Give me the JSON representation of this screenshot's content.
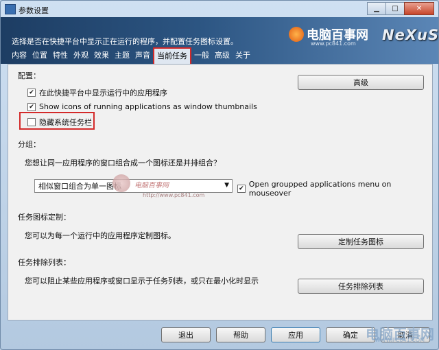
{
  "window": {
    "title": "参数设置"
  },
  "header": {
    "description": "选择是否在快捷平台中显示正在运行的程序，并配置任务图标设置。",
    "brand": "NeXuS",
    "watermark": {
      "name": "电脑百事网",
      "url": "www.pc841.com"
    }
  },
  "tabs": [
    {
      "label": "内容"
    },
    {
      "label": "位置"
    },
    {
      "label": "特性"
    },
    {
      "label": "外观"
    },
    {
      "label": "效果"
    },
    {
      "label": "主题"
    },
    {
      "label": "声音"
    },
    {
      "label": "当前任务",
      "active": true
    },
    {
      "label": "一般"
    },
    {
      "label": "高级"
    },
    {
      "label": "关于"
    }
  ],
  "config": {
    "title": "配置：",
    "advanced_button": "高级",
    "options": [
      {
        "label": "在此快捷平台中显示运行中的应用程序",
        "checked": true
      },
      {
        "label": "Show icons of running applications as window thumbnails",
        "checked": true
      },
      {
        "label": "隐藏系统任务栏",
        "checked": false
      }
    ]
  },
  "group": {
    "title": "分组：",
    "question": "您想让同一应用程序的窗口组合成一个图标还是并排组合？",
    "dropdown_value": "相似窗口组合为单一图标",
    "menu_option": {
      "label": "Open groupped applications menu on mouseover",
      "checked": true
    },
    "watermark": {
      "name": "电脑百事网",
      "url": "http://www.pc841.com"
    }
  },
  "task_icon": {
    "title": "任务图标定制：",
    "desc": "您可以为每一个运行中的应用程序定制图标。",
    "button": "定制任务图标"
  },
  "exclude": {
    "title": "任务排除列表：",
    "desc": "您可以阻止某些应用程序或窗口显示于任务列表，或只在最小化时显示",
    "button": "任务排除列表"
  },
  "footer": {
    "exit": "退出",
    "help": "帮助",
    "apply": "应用",
    "ok": "确定",
    "cancel": "取消",
    "watermark": {
      "name": "电脑百事网",
      "url": "WWW.PC841.COM"
    }
  },
  "colors": {
    "highlight": "#d32a2a",
    "header_dark": "#1d3d63"
  }
}
